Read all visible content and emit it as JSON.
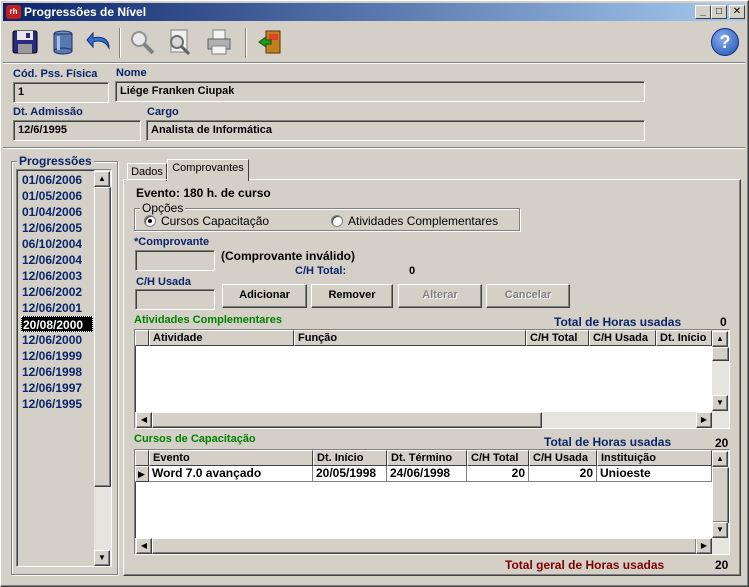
{
  "window": {
    "title": "Progressões de Nível",
    "app_icon_text": "rh",
    "minimize": "_",
    "maximize": "□",
    "close": "✕"
  },
  "toolbar": {
    "icons": [
      "save-icon",
      "database-icon",
      "undo-icon",
      "search-icon",
      "preview-icon",
      "print-icon",
      "exit-icon"
    ],
    "help": "?"
  },
  "person": {
    "cod_label": "Cód. Pss. Física",
    "cod_value": "1",
    "nome_label": "Nome",
    "nome_value": "Liége Franken Ciupak",
    "admissao_label": "Dt. Admissão",
    "admissao_value": "12/6/1995",
    "cargo_label": "Cargo",
    "cargo_value": "Analista de Informática"
  },
  "progressoes": {
    "label": "Progressões",
    "items": [
      "01/06/2006",
      "01/05/2006",
      "01/04/2006",
      "12/06/2005",
      "06/10/2004",
      "12/06/2004",
      "12/06/2003",
      "12/06/2002",
      "12/06/2001",
      "20/08/2000",
      "12/06/2000",
      "12/06/1999",
      "12/06/1998",
      "12/06/1997",
      "12/06/1995"
    ],
    "selected_index": 9
  },
  "tabs": {
    "dados": "Dados",
    "comprovantes": "Comprovantes"
  },
  "comprovantes": {
    "evento": "Evento: 180 h. de curso",
    "opcoes_label": "Opções",
    "opt_cursos": "Cursos Capacitação",
    "opt_atividades": "Atividades Complementares",
    "comprovante_label": "*Comprovante",
    "comprovante_value": "",
    "comprovante_status": "(Comprovante inválido)",
    "ch_total_label": "C/H Total:",
    "ch_total_value": "0",
    "ch_usada_label": "C/H Usada",
    "ch_usada_value": "",
    "btn_adicionar": "Adicionar",
    "btn_remover": "Remover",
    "btn_alterar": "Alterar",
    "btn_cancelar": "Cancelar"
  },
  "atividades": {
    "title": "Atividades Complementares",
    "total_label": "Total de Horas usadas",
    "total_value": "0",
    "columns": [
      "Atividade",
      "Função",
      "C/H Total",
      "C/H Usada",
      "Dt. Início"
    ],
    "rows": []
  },
  "cursos": {
    "title": "Cursos de Capacitação",
    "total_label": "Total de Horas usadas",
    "total_value": "20",
    "columns": [
      "Evento",
      "Dt. Início",
      "Dt. Término",
      "C/H Total",
      "C/H Usada",
      "Instituição"
    ],
    "rows": [
      {
        "evento": "Word 7.0 avançado",
        "inicio": "20/05/1998",
        "termino": "24/06/1998",
        "ch_total": "20",
        "ch_usada": "20",
        "instituicao": "Unioeste"
      }
    ]
  },
  "footer": {
    "total_geral_label": "Total geral de Horas usadas",
    "total_geral_value": "20"
  },
  "colors": {
    "title_start": "#0a246a",
    "title_end": "#a6caf0",
    "label_blue": "#0a246a",
    "label_green": "#008000",
    "label_darkred": "#800000",
    "selection": "#000000"
  }
}
